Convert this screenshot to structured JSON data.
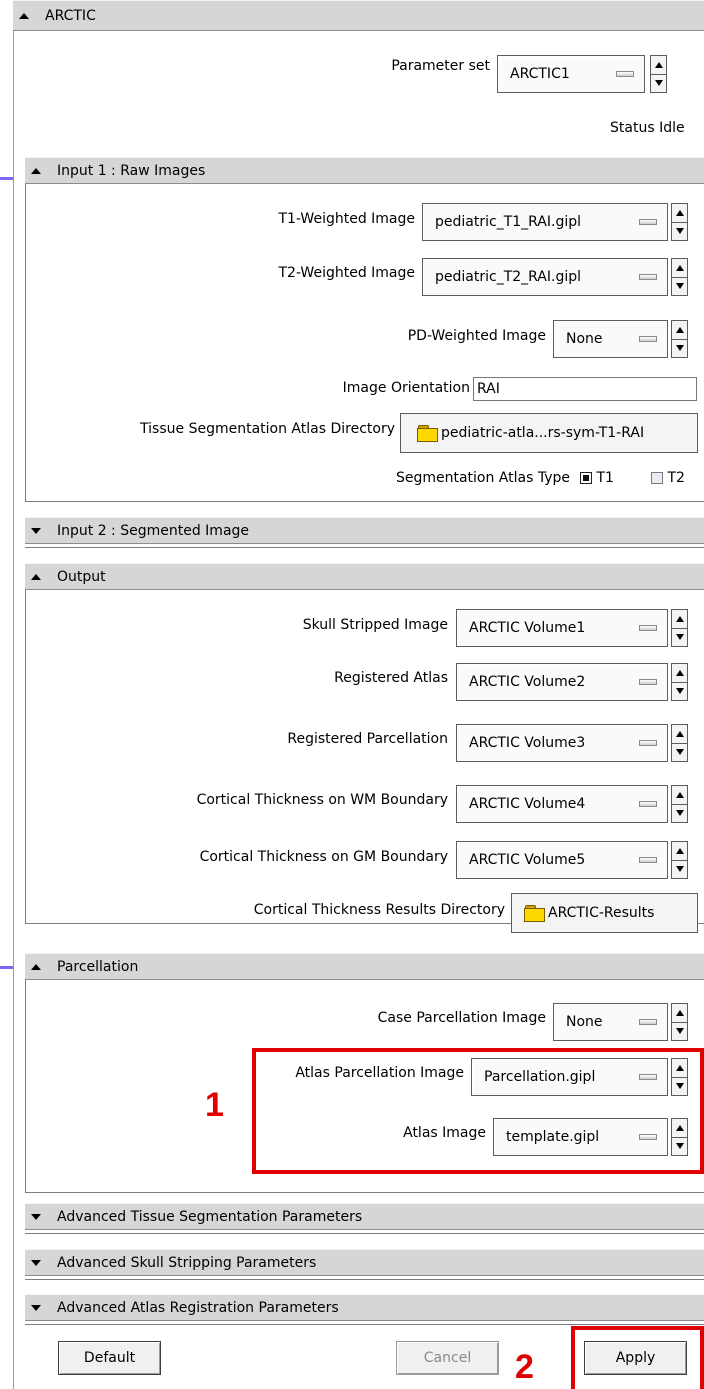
{
  "arctic": {
    "header": "ARCTIC",
    "parameter_set_label": "Parameter set",
    "parameter_set_value": "ARCTIC1",
    "status_label": "Status",
    "status_value": "Idle"
  },
  "input1": {
    "header": "Input 1 : Raw Images",
    "t1_label": "T1-Weighted Image",
    "t1_value": "pediatric_T1_RAI.gipl",
    "t2_label": "T2-Weighted Image",
    "t2_value": "pediatric_T2_RAI.gipl",
    "pd_label": "PD-Weighted Image",
    "pd_value": "None",
    "orientation_label": "Image Orientation",
    "orientation_value": "RAI",
    "atlas_dir_label": "Tissue Segmentation Atlas Directory",
    "atlas_dir_value": "pediatric-atla...rs-sym-T1-RAI",
    "atlas_type_label": "Segmentation Atlas Type",
    "atlas_type_options": [
      "T1",
      "T2"
    ],
    "atlas_type_selected": "T1"
  },
  "input2": {
    "header": "Input 2 : Segmented Image"
  },
  "output": {
    "header": "Output",
    "skull_label": "Skull Stripped Image",
    "skull_value": "ARCTIC Volume1",
    "reg_atlas_label": "Registered Atlas",
    "reg_atlas_value": "ARCTIC Volume2",
    "reg_parc_label": "Registered Parcellation",
    "reg_parc_value": "ARCTIC Volume3",
    "ct_wm_label": "Cortical Thickness on WM Boundary",
    "ct_wm_value": "ARCTIC Volume4",
    "ct_gm_label": "Cortical Thickness on GM Boundary",
    "ct_gm_value": "ARCTIC Volume5",
    "ct_dir_label": "Cortical Thickness Results Directory",
    "ct_dir_value": "ARCTIC-Results"
  },
  "parcellation": {
    "header": "Parcellation",
    "case_label": "Case Parcellation Image",
    "case_value": "None",
    "atlas_parc_label": "Atlas Parcellation Image",
    "atlas_parc_value": "Parcellation.gipl",
    "atlas_image_label": "Atlas Image",
    "atlas_image_value": "template.gipl"
  },
  "advanced": {
    "tissue_header": "Advanced Tissue Segmentation Parameters",
    "skull_header": "Advanced Skull Stripping Parameters",
    "atlas_reg_header": "Advanced Atlas Registration Parameters"
  },
  "buttons": {
    "default": "Default",
    "cancel": "Cancel",
    "apply": "Apply"
  },
  "annotations": {
    "one": "1",
    "two": "2",
    "color": "#e00000"
  }
}
